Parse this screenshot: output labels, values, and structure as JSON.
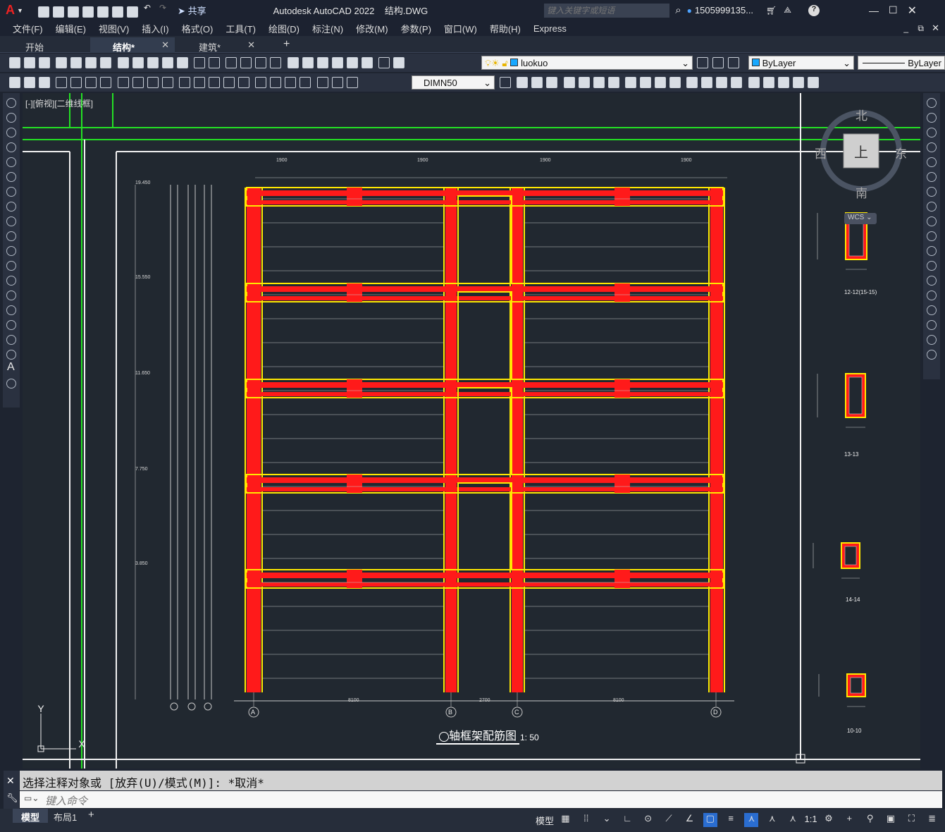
{
  "app": {
    "title": "Autodesk AutoCAD 2022",
    "document": "结构.DWG",
    "search_placeholder": "键入关键字或短语",
    "user": "1505999135...",
    "share": "共享"
  },
  "menu": [
    "文件(F)",
    "编辑(E)",
    "视图(V)",
    "插入(I)",
    "格式(O)",
    "工具(T)",
    "绘图(D)",
    "标注(N)",
    "修改(M)",
    "参数(P)",
    "窗口(W)",
    "帮助(H)",
    "Express"
  ],
  "file_tabs": [
    {
      "label": "开始"
    },
    {
      "label": "结构*",
      "active": true
    },
    {
      "label": "建筑*"
    }
  ],
  "toolbar": {
    "layer_name": "luokuo",
    "color_value": "ByLayer",
    "linetype_value": "ByLayer",
    "dim_style": "DIMN50"
  },
  "viewport": {
    "label": "[-][俯视][二维线框]"
  },
  "viewcube": {
    "north": "北",
    "south": "南",
    "east": "东",
    "west": "西",
    "top": "上",
    "wcs": "WCS"
  },
  "drawing": {
    "title": "轴框架配筋图",
    "scale": "1: 50",
    "elevations": [
      "19.450",
      "15.550",
      "11.650",
      "7.750",
      "3.850"
    ],
    "axis_labels": [
      "A",
      "B",
      "C",
      "D"
    ],
    "bottom_dims": [
      "8100",
      "2700",
      "8100"
    ],
    "sections": [
      "12-12(15-15)",
      "13-13",
      "14-14",
      "10-10"
    ],
    "top_dims": [
      "1900",
      "1900",
      "1900",
      "1900"
    ]
  },
  "command": {
    "history": "选择注释对象或 [放弃(U)/模式(M)]: *取消*",
    "placeholder": "键入命令"
  },
  "layout_tabs": [
    {
      "label": "模型",
      "active": true
    },
    {
      "label": "布局1"
    }
  ],
  "status": {
    "model": "模型",
    "scale": "1:1"
  },
  "colors": {
    "accent": "#d82020",
    "frame_red": "#ff1a1a",
    "frame_yellow": "#ffe800",
    "grid_green": "#24e024"
  }
}
